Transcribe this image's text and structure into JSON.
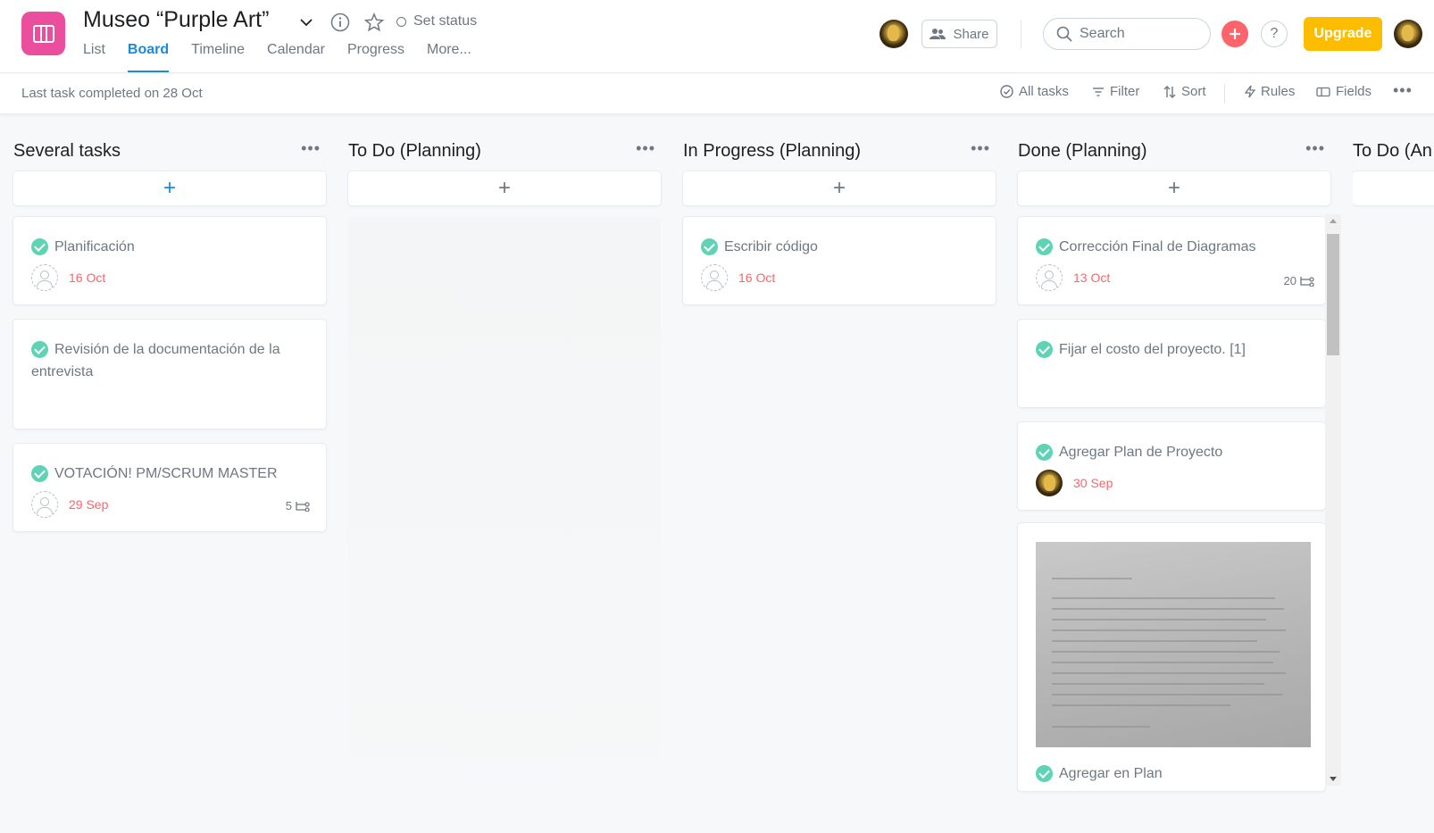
{
  "project": {
    "title": "Museo “Purple Art”",
    "set_status": "Set status",
    "icon_color": "#ea4e9d"
  },
  "tabs": [
    "List",
    "Board",
    "Timeline",
    "Calendar",
    "Progress",
    "More..."
  ],
  "active_tab": "Board",
  "header": {
    "share_label": "Share",
    "search_placeholder": "Search",
    "upgrade_label": "Upgrade",
    "help_label": "?"
  },
  "subbar": {
    "last_task": "Last task completed on 28 Oct",
    "all_tasks": "All tasks",
    "filter": "Filter",
    "sort": "Sort",
    "rules": "Rules",
    "fields": "Fields"
  },
  "columns": [
    {
      "title": "Several tasks",
      "cards": [
        {
          "name": "Planificación",
          "due": "16 Oct"
        },
        {
          "name": "Revisión de la documentación de la entrevista"
        },
        {
          "name": "VOTACIÓN! PM/SCRUM MASTER",
          "due": "29 Sep",
          "subtasks": "5"
        }
      ]
    },
    {
      "title": "To Do (Planning)",
      "cards": []
    },
    {
      "title": "In Progress (Planning)",
      "cards": [
        {
          "name": "Escribir código",
          "due": "16 Oct"
        }
      ]
    },
    {
      "title": "Done (Planning)",
      "cards": [
        {
          "name": "Corrección Final de Diagramas",
          "due": "13 Oct",
          "subtasks": "20"
        },
        {
          "name": "Fijar el costo del proyecto. [1]"
        },
        {
          "name": "Agregar Plan de Proyecto",
          "due": "30 Sep"
        },
        {
          "name": "Agregar en Plan",
          "has_cover": true
        }
      ]
    },
    {
      "title": "To Do (An",
      "cards": []
    }
  ],
  "colors": {
    "accent": "#1d8ad7",
    "complete": "#5fd3b5",
    "due": "#fc636b",
    "upgrade": "#fcbd01",
    "add": "#fc636b"
  }
}
